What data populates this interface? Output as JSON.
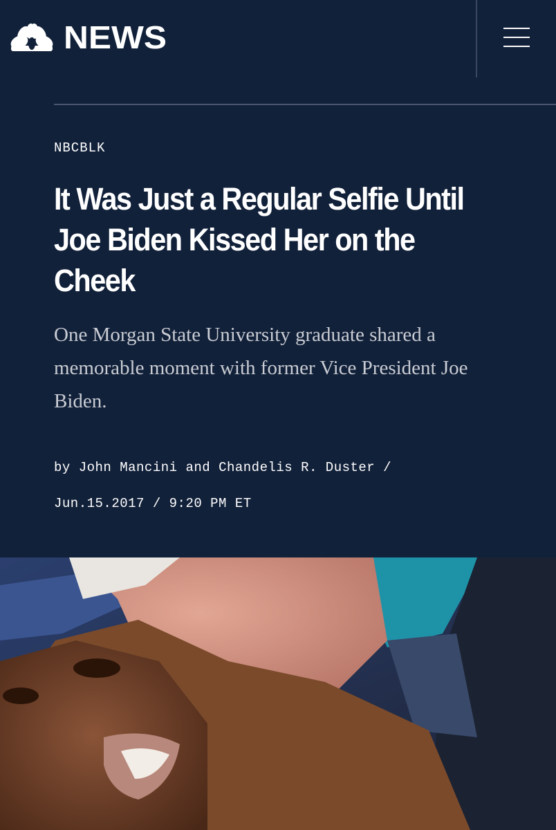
{
  "header": {
    "logo_text": "NEWS",
    "logo_icon": "peacock-icon",
    "menu_icon": "hamburger-menu-icon"
  },
  "article": {
    "kicker": "NBCBLK",
    "headline": "It Was Just a Regular Selfie Until Joe Biden Kissed Her on the Cheek",
    "dek": "One Morgan State University graduate shared a memorable moment with former Vice President Joe Biden.",
    "byline_prefix": "by",
    "author_1": "John Mancini",
    "byline_and": "and",
    "author_2": "Chandelis R. Duster",
    "separator": "/",
    "date": "Jun.15.2017",
    "time": "9:20 PM ET"
  },
  "colors": {
    "background": "#12213a",
    "text": "#ffffff",
    "dek_text": "#c9ccd3"
  }
}
